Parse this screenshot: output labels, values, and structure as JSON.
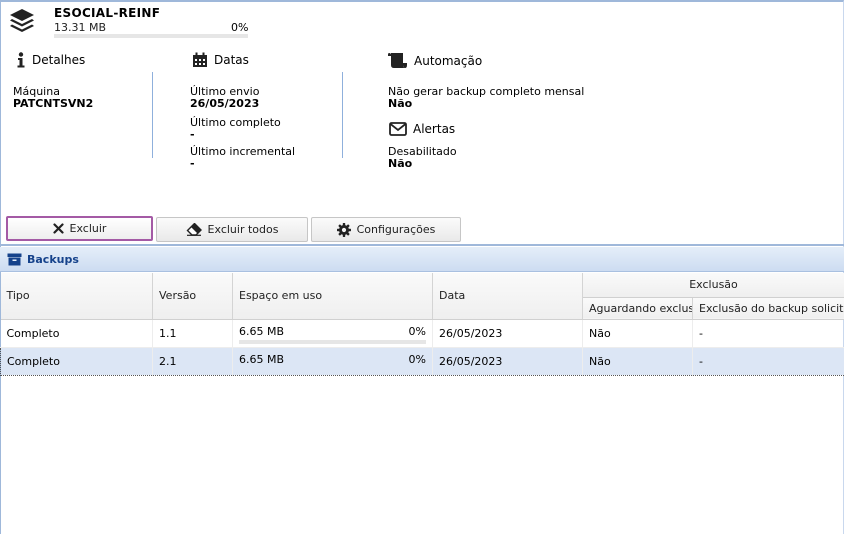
{
  "header": {
    "title": "ESOCIAL-REINF",
    "size": "13.31 MB",
    "percent": "0%",
    "progress": 0
  },
  "details": {
    "heading": "Detalhes",
    "machine_label": "Máquina",
    "machine_value": "PATCNTSVN2"
  },
  "dates": {
    "heading": "Datas",
    "last_send_label": "Último envio",
    "last_send_value": "26/05/2023",
    "last_full_label": "Último completo",
    "last_full_value": "-",
    "last_incremental_label": "Último incremental",
    "last_incremental_value": "-"
  },
  "automation": {
    "heading": "Automação",
    "monthly_label": "Não gerar backup completo mensal",
    "monthly_value": "Não"
  },
  "alerts": {
    "heading": "Alertas",
    "disabled_label": "Desabilitado",
    "disabled_value": "Não"
  },
  "toolbar": {
    "delete_label": "Excluir",
    "delete_all_label": "Excluir todos",
    "settings_label": "Configurações"
  },
  "panel": {
    "title": "Backups"
  },
  "table": {
    "columns": {
      "tipo": "Tipo",
      "versao": "Versão",
      "espaco": "Espaço em uso",
      "data": "Data",
      "exclusao_group": "Exclusão",
      "aguardando": "Aguardando exclusã",
      "solicitada": "Exclusão do backup solicitad"
    },
    "rows": [
      {
        "tipo": "Completo",
        "versao": "1.1",
        "espaco": "6.65 MB",
        "percent": "0%",
        "progress": 0,
        "data": "26/05/2023",
        "aguardando": "Não",
        "solicitada": "-"
      },
      {
        "tipo": "Completo",
        "versao": "2.1",
        "espaco": "6.65 MB",
        "percent": "0%",
        "progress": 0,
        "data": "26/05/2023",
        "aguardando": "Não",
        "solicitada": "-"
      }
    ]
  },
  "colors": {
    "accent": "#15428b",
    "selection": "#dce6f5",
    "active_button_border": "#a45aa5"
  },
  "icons": {
    "header": "layers-icon",
    "details": "info-icon",
    "dates": "calendar-icon",
    "automation": "scroll-icon",
    "alerts": "envelope-icon",
    "delete": "close-icon",
    "delete_all": "eraser-icon",
    "settings": "gear-icon",
    "panel": "archive-box-icon"
  }
}
